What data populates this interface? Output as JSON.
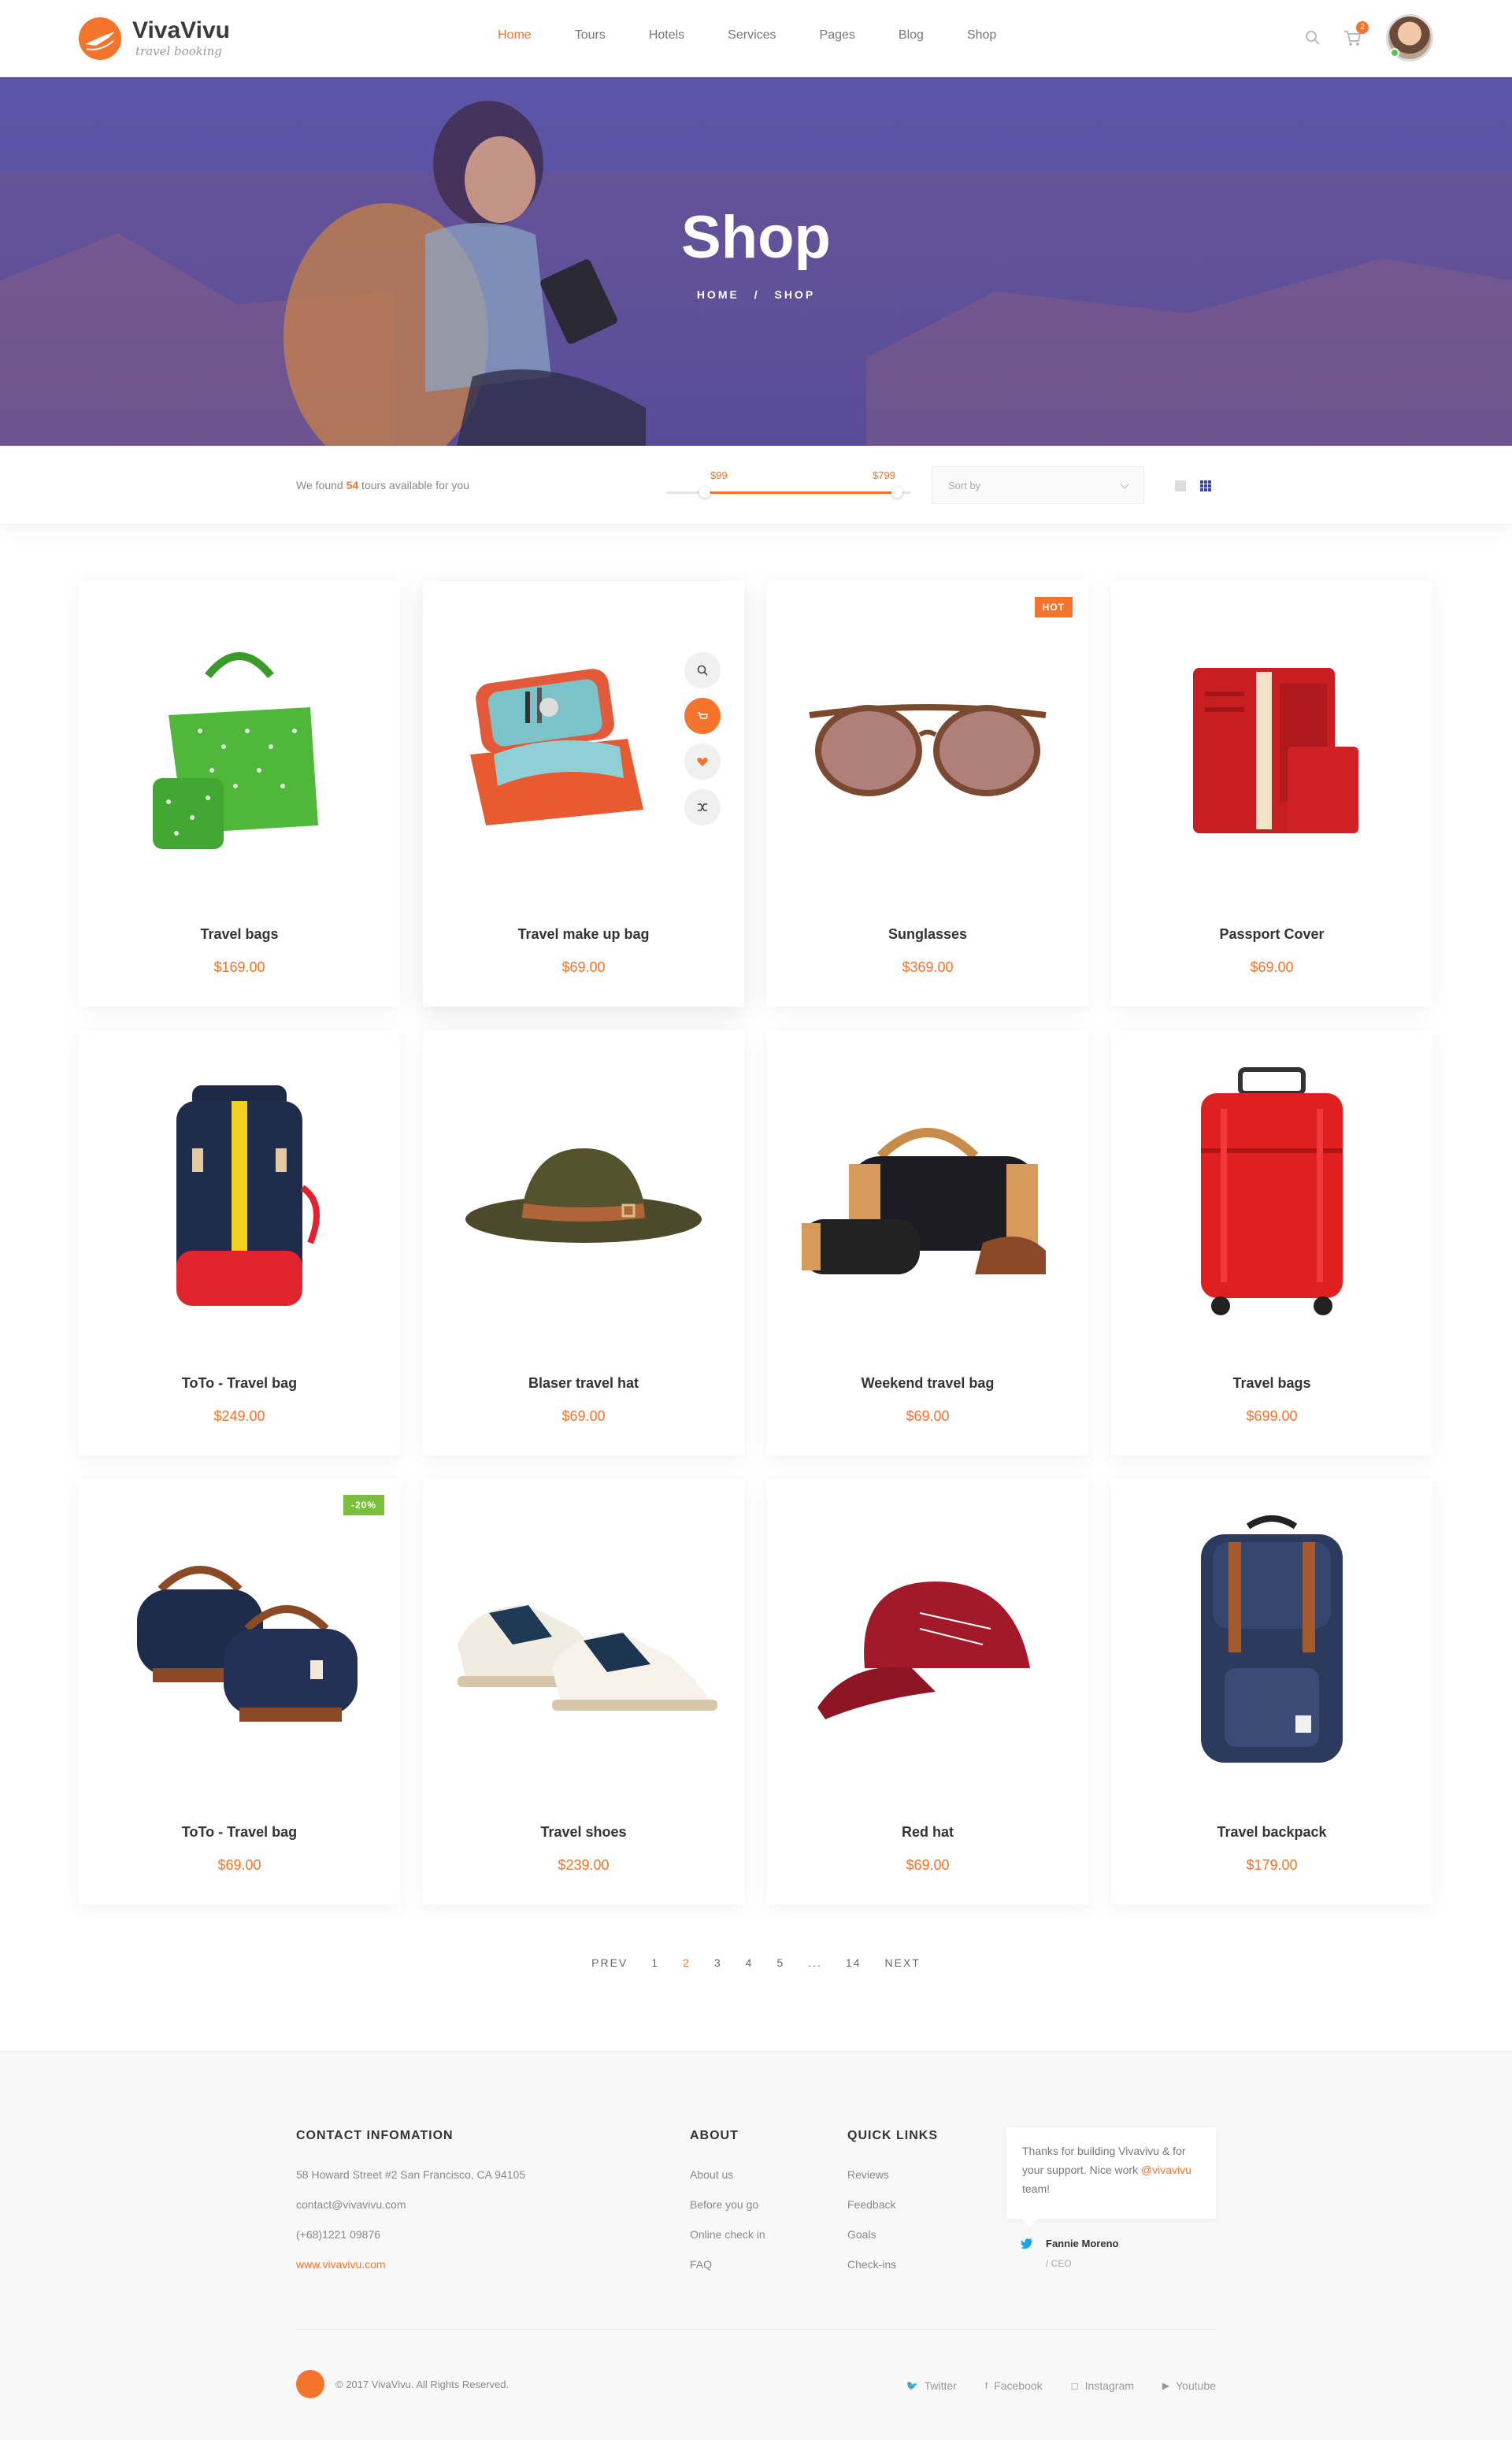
{
  "brand": {
    "name": "VivaVivu",
    "tagline": "travel booking"
  },
  "nav": [
    "Home",
    "Tours",
    "Hotels",
    "Services",
    "Pages",
    "Blog",
    "Shop"
  ],
  "cart_count": "2",
  "hero": {
    "title": "Shop",
    "crumb_home": "HOME",
    "crumb_sep": "/",
    "crumb_current": "SHOP"
  },
  "filter": {
    "found_prefix": "We found",
    "found_count": "54",
    "found_suffix": "tours available for you",
    "price_min": "$99",
    "price_max": "$799",
    "sort_placeholder": "Sort by"
  },
  "products": [
    {
      "name": "Travel bags",
      "price": "$169.00"
    },
    {
      "name": "Travel make up bag",
      "price": "$69.00"
    },
    {
      "name": "Sunglasses",
      "price": "$369.00",
      "badge": "HOT"
    },
    {
      "name": "Passport Cover",
      "price": "$69.00"
    },
    {
      "name": "ToTo - Travel bag",
      "price": "$249.00"
    },
    {
      "name": "Blaser travel hat",
      "price": "$69.00"
    },
    {
      "name": "Weekend travel bag",
      "price": "$69.00"
    },
    {
      "name": "Travel bags",
      "price": "$699.00"
    },
    {
      "name": "ToTo - Travel bag",
      "price": "$69.00",
      "badge": "-20%"
    },
    {
      "name": "Travel shoes",
      "price": "$239.00"
    },
    {
      "name": "Red hat",
      "price": "$69.00"
    },
    {
      "name": "Travel backpack",
      "price": "$179.00"
    }
  ],
  "pagination": [
    "PREV",
    "1",
    "2",
    "3",
    "4",
    "5",
    "...",
    "14",
    "NEXT"
  ],
  "pagination_current": "2",
  "footer": {
    "contact": {
      "title": "CONTACT INFOMATION",
      "address": "58 Howard Street #2 San Francisco, CA 94105",
      "email": "contact@vivavivu.com",
      "phone": "(+68)1221 09876",
      "website": "www.vivavivu.com"
    },
    "about": {
      "title": "ABOUT",
      "links": [
        "About us",
        "Before you go",
        "Online check in",
        "FAQ"
      ]
    },
    "quick": {
      "title": "QUICK LINKS",
      "links": [
        "Reviews",
        "Feedback",
        "Goals",
        "Check-ins"
      ]
    },
    "tweet": {
      "text_before": "Thanks for building Vivavivu & for your support. Nice work",
      "handle": "@vivavivu",
      "text_after": "team!",
      "author": "Fannie Moreno",
      "role": "/ CEO"
    },
    "copyright": "© 2017 VivaVivu. All Rights Reserved.",
    "social": [
      "Twitter",
      "Facebook",
      "Instagram",
      "Youtube"
    ]
  },
  "colors": {
    "accent": "#f4742b",
    "sale": "#7bbf3a",
    "hero_tint": "#5a55a8"
  }
}
